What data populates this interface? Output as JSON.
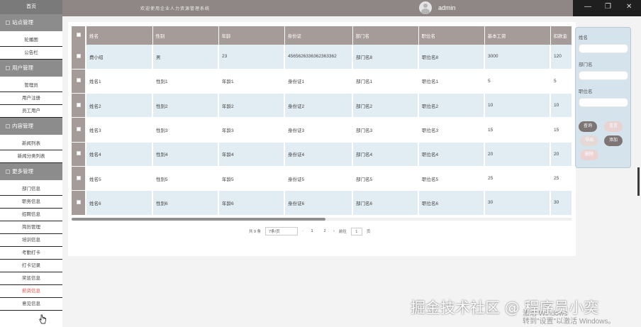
{
  "sidebar": {
    "home": "首页",
    "groups": [
      {
        "title": "站点管理",
        "items": [
          "轮播图",
          "公告栏"
        ]
      },
      {
        "title": "用户管理",
        "items": [
          "管理员",
          "用户注册",
          "员工用户"
        ]
      },
      {
        "title": "内容管理",
        "items": [
          "新闻列表",
          "新闻分类列表"
        ]
      },
      {
        "title": "更多管理",
        "items": [
          "部门信息",
          "职务信息",
          "招聘信息",
          "简历管理",
          "培训信息",
          "考勤打卡",
          "打卡记录",
          "奖惩信息",
          "薪资信息",
          "意见信息"
        ]
      }
    ],
    "active_item": "薪资信息"
  },
  "header": {
    "title": "欢迎使用企业人力资源管理系统",
    "username": "admin"
  },
  "window_controls": {
    "minimize": "—",
    "maximize": "❐",
    "close": "✕"
  },
  "table": {
    "columns": [
      "姓名",
      "性别",
      "年龄",
      "身份证",
      "部门名",
      "职位名",
      "基本工资",
      "扣款金"
    ],
    "rows": [
      [
        "费小绍",
        "男",
        "23",
        "4565626336362363362",
        "部门名8",
        "职位名8",
        "3000",
        "120"
      ],
      [
        "姓名1",
        "性别1",
        "年龄1",
        "身份证1",
        "部门名1",
        "职位名1",
        "5",
        "5"
      ],
      [
        "姓名2",
        "性别2",
        "年龄2",
        "身份证2",
        "部门名2",
        "职位名2",
        "10",
        "10"
      ],
      [
        "姓名3",
        "性别3",
        "年龄3",
        "身份证3",
        "部门名3",
        "职位名3",
        "15",
        "15"
      ],
      [
        "姓名4",
        "性别4",
        "年龄4",
        "身份证4",
        "部门名4",
        "职位名4",
        "20",
        "20"
      ],
      [
        "姓名5",
        "性别5",
        "年龄5",
        "身份证5",
        "部门名5",
        "职位名5",
        "25",
        "25"
      ],
      [
        "姓名6",
        "性别6",
        "年龄6",
        "身份证6",
        "部门名6",
        "职位名6",
        "30",
        "30"
      ]
    ]
  },
  "pagination": {
    "total": "共 9 条",
    "page_size": "7条/页",
    "prev": "‹",
    "pages": [
      "1",
      "2"
    ],
    "next": "›",
    "goto_label": "前往",
    "goto_value": "1",
    "goto_suffix": "页"
  },
  "search_panel": {
    "name_label": "姓名",
    "dept_label": "部门名",
    "position_label": "职位名",
    "search_btn": "查询",
    "reset_btn": "重置",
    "export_btn": "导出",
    "add_btn": "添加",
    "delete_btn": "删除"
  },
  "watermark": "掘金技术社区 @ 程序员小奕",
  "activate_windows": {
    "line1": "激活 Windows",
    "line2": "转到\"设置\"以激活 Windows。"
  }
}
